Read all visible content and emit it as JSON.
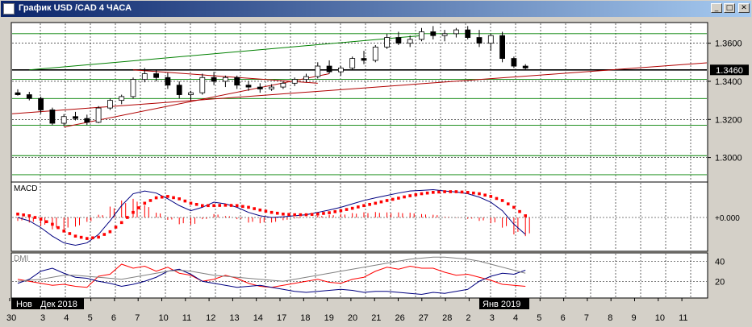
{
  "window": {
    "title": "График USD /CAD  4 ЧАСА",
    "buttons": {
      "minimize": "_",
      "maximize": "□",
      "close": "✕"
    },
    "colors": {
      "titlebar_start": "#0a246a",
      "titlebar_end": "#a6caf0"
    }
  },
  "chart_data": [
    {
      "type": "candlestick",
      "series": [
        {
          "x": 0,
          "open": 1.334,
          "high": 1.3358,
          "low": 1.3325,
          "close": 1.333
        },
        {
          "x": 1,
          "open": 1.333,
          "high": 1.3345,
          "low": 1.33,
          "close": 1.331
        },
        {
          "x": 2,
          "open": 1.331,
          "high": 1.332,
          "low": 1.323,
          "close": 1.325
        },
        {
          "x": 3,
          "open": 1.325,
          "high": 1.3262,
          "low": 1.317,
          "close": 1.318
        },
        {
          "x": 4,
          "open": 1.318,
          "high": 1.3228,
          "low": 1.3165,
          "close": 1.3215
        },
        {
          "x": 5,
          "open": 1.3215,
          "high": 1.324,
          "low": 1.3195,
          "close": 1.3205
        },
        {
          "x": 6,
          "open": 1.3205,
          "high": 1.3225,
          "low": 1.317,
          "close": 1.3185
        },
        {
          "x": 7,
          "open": 1.3185,
          "high": 1.327,
          "low": 1.318,
          "close": 1.326
        },
        {
          "x": 8,
          "open": 1.326,
          "high": 1.331,
          "low": 1.325,
          "close": 1.33
        },
        {
          "x": 9,
          "open": 1.33,
          "high": 1.333,
          "low": 1.328,
          "close": 1.332
        },
        {
          "x": 10,
          "open": 1.332,
          "high": 1.342,
          "low": 1.331,
          "close": 1.341
        },
        {
          "x": 11,
          "open": 1.341,
          "high": 1.347,
          "low": 1.3395,
          "close": 1.344
        },
        {
          "x": 12,
          "open": 1.344,
          "high": 1.346,
          "low": 1.34,
          "close": 1.342
        },
        {
          "x": 13,
          "open": 1.342,
          "high": 1.3445,
          "low": 1.336,
          "close": 1.338
        },
        {
          "x": 14,
          "open": 1.338,
          "high": 1.34,
          "low": 1.331,
          "close": 1.333
        },
        {
          "x": 15,
          "open": 1.333,
          "high": 1.335,
          "low": 1.33,
          "close": 1.334
        },
        {
          "x": 16,
          "open": 1.334,
          "high": 1.344,
          "low": 1.333,
          "close": 1.342
        },
        {
          "x": 17,
          "open": 1.342,
          "high": 1.345,
          "low": 1.338,
          "close": 1.34
        },
        {
          "x": 18,
          "open": 1.34,
          "high": 1.343,
          "low": 1.337,
          "close": 1.342
        },
        {
          "x": 19,
          "open": 1.342,
          "high": 1.343,
          "low": 1.336,
          "close": 1.338
        },
        {
          "x": 20,
          "open": 1.338,
          "high": 1.34,
          "low": 1.335,
          "close": 1.337
        },
        {
          "x": 21,
          "open": 1.337,
          "high": 1.339,
          "low": 1.334,
          "close": 1.336
        },
        {
          "x": 22,
          "open": 1.336,
          "high": 1.3385,
          "low": 1.335,
          "close": 1.337
        },
        {
          "x": 23,
          "open": 1.337,
          "high": 1.34,
          "low": 1.336,
          "close": 1.339
        },
        {
          "x": 24,
          "open": 1.339,
          "high": 1.342,
          "low": 1.3375,
          "close": 1.341
        },
        {
          "x": 25,
          "open": 1.341,
          "high": 1.344,
          "low": 1.3395,
          "close": 1.3425
        },
        {
          "x": 26,
          "open": 1.3425,
          "high": 1.35,
          "low": 1.3415,
          "close": 1.348
        },
        {
          "x": 27,
          "open": 1.348,
          "high": 1.351,
          "low": 1.344,
          "close": 1.345
        },
        {
          "x": 28,
          "open": 1.345,
          "high": 1.348,
          "low": 1.343,
          "close": 1.347
        },
        {
          "x": 29,
          "open": 1.347,
          "high": 1.353,
          "low": 1.346,
          "close": 1.352
        },
        {
          "x": 30,
          "open": 1.352,
          "high": 1.356,
          "low": 1.349,
          "close": 1.351
        },
        {
          "x": 31,
          "open": 1.351,
          "high": 1.359,
          "low": 1.35,
          "close": 1.358
        },
        {
          "x": 32,
          "open": 1.358,
          "high": 1.365,
          "low": 1.357,
          "close": 1.363
        },
        {
          "x": 33,
          "open": 1.363,
          "high": 1.366,
          "low": 1.359,
          "close": 1.36
        },
        {
          "x": 34,
          "open": 1.36,
          "high": 1.364,
          "low": 1.358,
          "close": 1.362
        },
        {
          "x": 35,
          "open": 1.362,
          "high": 1.368,
          "low": 1.361,
          "close": 1.366
        },
        {
          "x": 36,
          "open": 1.366,
          "high": 1.369,
          "low": 1.362,
          "close": 1.364
        },
        {
          "x": 37,
          "open": 1.364,
          "high": 1.367,
          "low": 1.361,
          "close": 1.365
        },
        {
          "x": 38,
          "open": 1.365,
          "high": 1.368,
          "low": 1.363,
          "close": 1.367
        },
        {
          "x": 39,
          "open": 1.367,
          "high": 1.369,
          "low": 1.362,
          "close": 1.363
        },
        {
          "x": 40,
          "open": 1.363,
          "high": 1.367,
          "low": 1.358,
          "close": 1.36
        },
        {
          "x": 41,
          "open": 1.36,
          "high": 1.365,
          "low": 1.356,
          "close": 1.364
        },
        {
          "x": 42,
          "open": 1.364,
          "high": 1.366,
          "low": 1.35,
          "close": 1.352
        },
        {
          "x": 43,
          "open": 1.352,
          "high": 1.353,
          "low": 1.347,
          "close": 1.348
        },
        {
          "x": 44,
          "open": 1.348,
          "high": 1.349,
          "low": 1.346,
          "close": 1.347
        }
      ],
      "ylim": [
        1.288,
        1.37
      ],
      "ytick_labels": [
        "1.3600",
        "1.3400",
        "1.3200",
        "1.3000"
      ],
      "yticks": [
        1.36,
        1.34,
        1.32,
        1.3
      ],
      "horizontal_levels": [
        1.365,
        1.346,
        1.341,
        1.331,
        1.317,
        1.301,
        1.291
      ],
      "current_price_label": "1.3460",
      "current_price": 1.346,
      "colors": {
        "candle": "#000000",
        "level": "#008000",
        "current_level": "#000000",
        "trend_red": "#b00000",
        "trend_green": "#008000"
      },
      "grid": true
    },
    {
      "type": "line",
      "indicator_label": "MACD",
      "zero_label": "+0.000",
      "x": [
        0,
        1,
        2,
        3,
        4,
        5,
        6,
        7,
        8,
        9,
        10,
        11,
        12,
        13,
        14,
        15,
        16,
        17,
        18,
        19,
        20,
        21,
        22,
        23,
        24,
        25,
        26,
        27,
        28,
        29,
        30,
        31,
        32,
        33,
        34,
        35,
        36,
        37,
        38,
        39,
        40,
        41,
        42,
        43,
        44
      ],
      "series": [
        {
          "name": "",
          "color": "#000080",
          "values": [
            0.0,
            -0.1,
            -0.3,
            -0.55,
            -0.75,
            -0.82,
            -0.75,
            -0.5,
            -0.1,
            0.35,
            0.7,
            0.78,
            0.72,
            0.55,
            0.35,
            0.2,
            0.3,
            0.45,
            0.4,
            0.3,
            0.15,
            0.05,
            0.0,
            0.02,
            0.05,
            0.08,
            0.15,
            0.22,
            0.3,
            0.4,
            0.5,
            0.58,
            0.65,
            0.72,
            0.78,
            0.8,
            0.82,
            0.78,
            0.75,
            0.7,
            0.6,
            0.45,
            0.2,
            -0.2,
            -0.5
          ]
        },
        {
          "name": "",
          "color": "#ff0000",
          "values": [
            0.1,
            0.05,
            -0.05,
            -0.2,
            -0.4,
            -0.55,
            -0.62,
            -0.58,
            -0.42,
            -0.15,
            0.15,
            0.42,
            0.58,
            0.62,
            0.55,
            0.42,
            0.35,
            0.35,
            0.36,
            0.35,
            0.3,
            0.22,
            0.15,
            0.1,
            0.08,
            0.08,
            0.1,
            0.14,
            0.2,
            0.27,
            0.35,
            0.42,
            0.5,
            0.57,
            0.64,
            0.7,
            0.74,
            0.76,
            0.76,
            0.74,
            0.7,
            0.62,
            0.5,
            0.3,
            0.05
          ]
        }
      ],
      "histogram": [
        -0.1,
        -0.15,
        -0.25,
        -0.35,
        -0.35,
        -0.27,
        -0.13,
        0.08,
        0.32,
        0.5,
        0.55,
        0.36,
        0.14,
        -0.07,
        -0.2,
        -0.22,
        -0.05,
        0.1,
        0.04,
        -0.05,
        -0.15,
        -0.17,
        -0.15,
        -0.08,
        -0.03,
        0.0,
        0.05,
        0.08,
        0.1,
        0.13,
        0.15,
        0.16,
        0.15,
        0.15,
        0.14,
        0.1,
        0.08,
        0.02,
        -0.01,
        -0.04,
        -0.1,
        -0.17,
        -0.3,
        -0.5,
        -0.55
      ],
      "ylim": [
        -0.95,
        0.95
      ]
    },
    {
      "type": "line",
      "indicator_label": "DMI",
      "ytick_labels": [
        "40",
        "20"
      ],
      "yticks": [
        40,
        20
      ],
      "ylim": [
        5,
        45
      ],
      "x": [
        0,
        1,
        2,
        3,
        4,
        5,
        6,
        7,
        8,
        9,
        10,
        11,
        12,
        13,
        14,
        15,
        16,
        17,
        18,
        19,
        20,
        21,
        22,
        23,
        24,
        25,
        26,
        27,
        28,
        29,
        30,
        31,
        32,
        33,
        34,
        35,
        36,
        37,
        38,
        39,
        40,
        41,
        42,
        43,
        44
      ],
      "series": [
        {
          "name": "",
          "color": "#ff0000",
          "values": [
            22,
            20,
            18,
            16,
            17,
            15,
            14,
            25,
            27,
            37,
            33,
            35,
            30,
            34,
            28,
            26,
            20,
            22,
            26,
            23,
            18,
            15,
            14,
            16,
            18,
            20,
            22,
            19,
            18,
            22,
            24,
            30,
            34,
            32,
            35,
            33,
            33,
            29,
            26,
            27,
            24,
            21,
            17,
            16,
            15
          ]
        },
        {
          "name": "",
          "color": "#000080",
          "values": [
            18,
            22,
            30,
            33,
            28,
            24,
            23,
            20,
            18,
            15,
            17,
            20,
            24,
            30,
            32,
            27,
            20,
            18,
            16,
            14,
            15,
            16,
            14,
            12,
            10,
            9,
            10,
            11,
            12,
            11,
            9,
            10,
            10,
            9,
            8,
            7,
            9,
            8,
            10,
            12,
            20,
            25,
            28,
            27,
            31
          ]
        },
        {
          "name": "",
          "color": "#808080",
          "values": [
            20,
            21,
            22,
            24,
            26,
            26,
            25,
            24,
            23,
            22,
            24,
            26,
            28,
            30,
            31,
            30,
            28,
            26,
            25,
            24,
            23,
            22,
            21,
            20,
            22,
            24,
            26,
            28,
            30,
            32,
            34,
            36,
            38,
            40,
            42,
            43,
            44,
            44,
            43,
            42,
            40,
            37,
            34,
            31,
            28
          ]
        }
      ]
    }
  ],
  "time_axis": {
    "labels": [
      "30",
      "3",
      "4",
      "5",
      "6",
      "7",
      "10",
      "11",
      "12",
      "13",
      "14",
      "17",
      "18",
      "19",
      "20",
      "21",
      "26",
      "27",
      "28",
      "2",
      "3",
      "4",
      "5",
      "6",
      "7",
      "8",
      "9",
      "10",
      "11"
    ],
    "period_labels": [
      "Нов",
      "Дек 2018",
      "Янв 2019"
    ]
  }
}
